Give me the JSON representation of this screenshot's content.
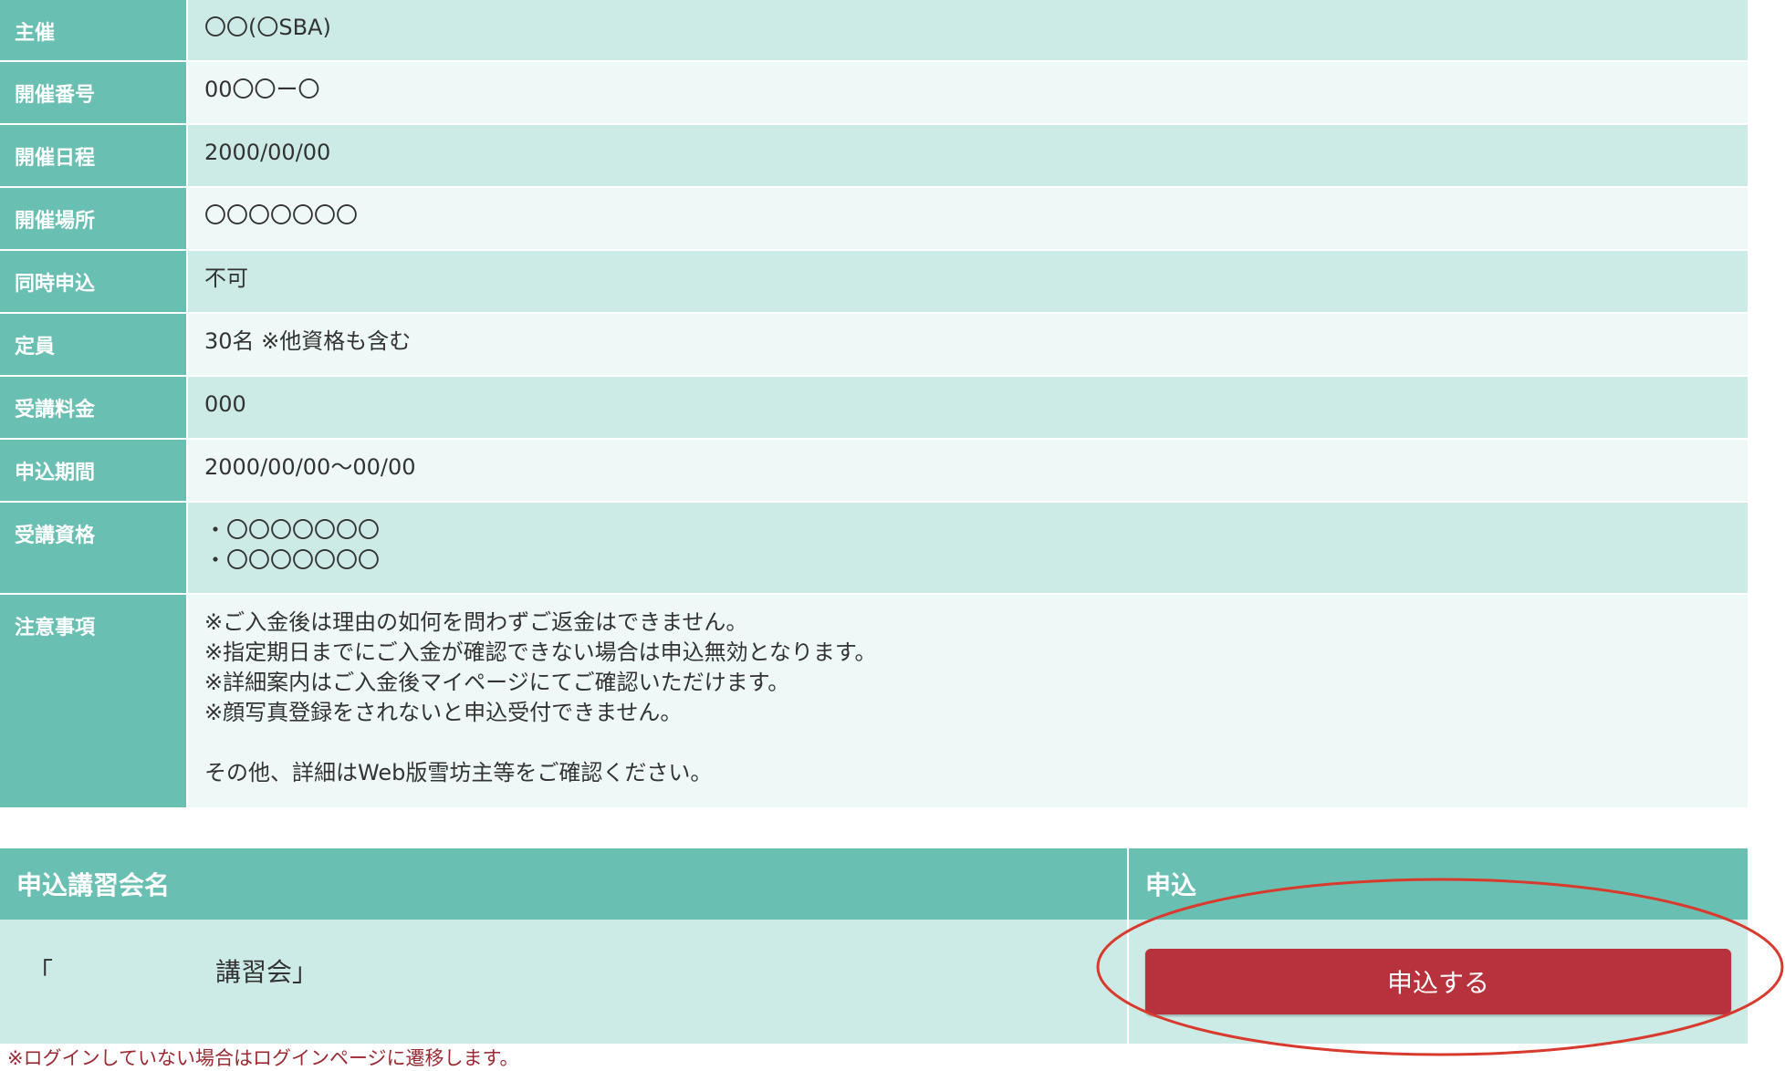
{
  "details": [
    {
      "label": "主催",
      "lines": [
        "〇〇(〇SBA)"
      ]
    },
    {
      "label": "開催番号",
      "lines": [
        "00〇〇ー〇"
      ]
    },
    {
      "label": "開催日程",
      "lines": [
        "2000/00/00"
      ]
    },
    {
      "label": "開催場所",
      "lines": [
        "〇〇〇〇〇〇〇"
      ]
    },
    {
      "label": "同時申込",
      "lines": [
        "不可"
      ]
    },
    {
      "label": "定員",
      "lines": [
        "30名 ※他資格も含む"
      ]
    },
    {
      "label": "受講料金",
      "lines": [
        "000"
      ]
    },
    {
      "label": "申込期間",
      "lines": [
        "2000/00/00〜00/00"
      ]
    },
    {
      "label": "受講資格",
      "lines": [
        "・〇〇〇〇〇〇〇",
        "・〇〇〇〇〇〇〇"
      ]
    },
    {
      "label": "注意事項",
      "lines": [
        "※ご入金後は理由の如何を問わずご返金はできません。",
        "※指定期日までにご入金が確認できない場合は申込無効となります。",
        "※詳細案内はご入金後マイページにてご確認いただけます。",
        "※顔写真登録をされないと申込受付できません。",
        "",
        "その他、詳細はWeb版雪坊主等をご確認ください。"
      ]
    }
  ],
  "apply_table": {
    "header_name": "申込講習会名",
    "header_apply": "申込",
    "course_name": "「                    講習会」",
    "apply_button_label": "申込する"
  },
  "login_note": "※ログインしていない場合はログインページに遷移します。",
  "colors": {
    "header_green": "#69bfb1",
    "row_dark": "#cdebe6",
    "row_light": "#eef8f6",
    "button_red": "#b8323d",
    "ellipse_red": "#d83a2e"
  }
}
